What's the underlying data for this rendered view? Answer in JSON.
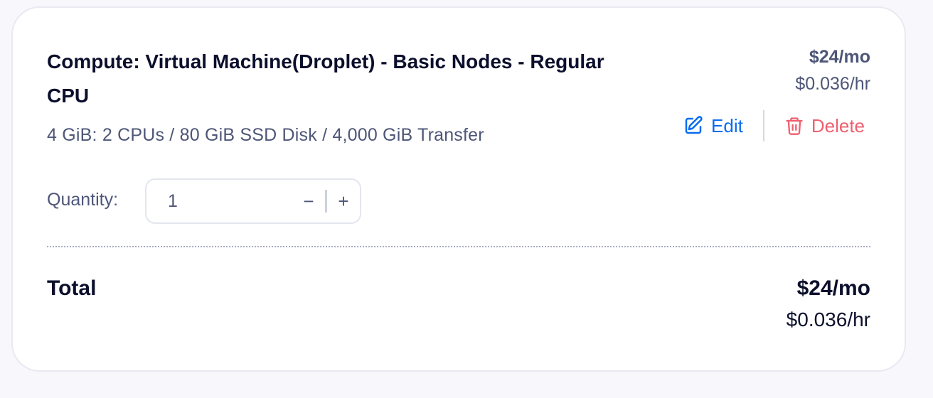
{
  "product": {
    "title": "Compute: Virtual Machine(Droplet) - Basic Nodes - Regular CPU",
    "spec": "4 GiB: 2 CPUs / 80 GiB SSD Disk / 4,000 GiB Transfer",
    "price_monthly": "$24/mo",
    "price_hourly": "$0.036/hr"
  },
  "actions": {
    "edit_label": "Edit",
    "edit_icon": "pencil-square-icon",
    "delete_label": "Delete",
    "delete_icon": "trash-icon"
  },
  "quantity": {
    "label": "Quantity:",
    "value": "1",
    "decrement_symbol": "−",
    "increment_symbol": "+"
  },
  "total": {
    "label": "Total",
    "monthly": "$24/mo",
    "hourly": "$0.036/hr"
  },
  "colors": {
    "accent_blue": "#0a6cf0",
    "danger_red": "#ef6070",
    "text_dark": "#0b0f2c",
    "text_muted": "#4e5678"
  }
}
